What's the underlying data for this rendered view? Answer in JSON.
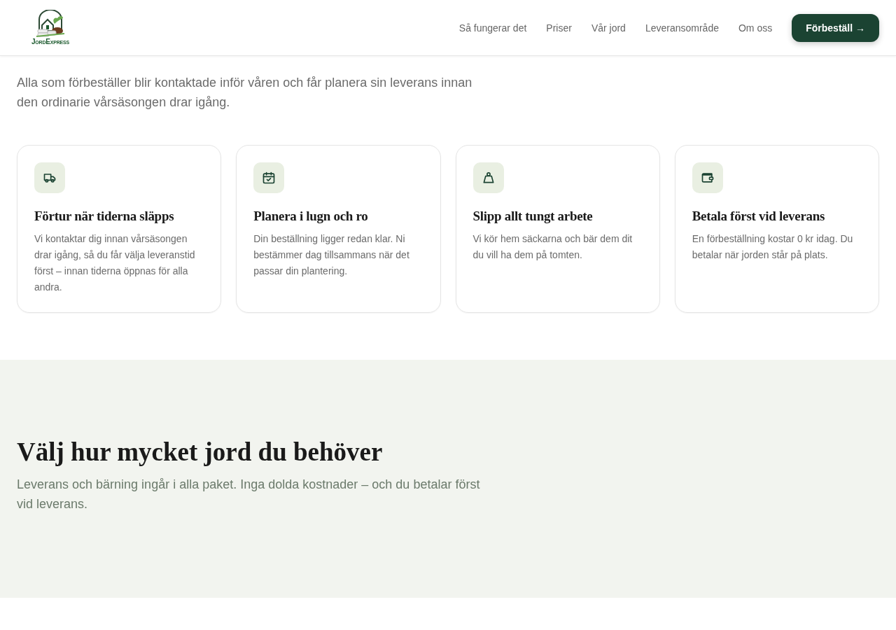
{
  "header": {
    "logo_text": "JordExpress",
    "nav": [
      {
        "label": "Så fungerar det"
      },
      {
        "label": "Priser"
      },
      {
        "label": "Vår jord"
      },
      {
        "label": "Leveransområde"
      },
      {
        "label": "Om oss"
      }
    ],
    "cta": "Förbeställ →"
  },
  "intro": {
    "text": "Alla som förbeställer blir kontaktade inför våren och får planera sin leverans innan den ordinarie vårsäsongen drar igång."
  },
  "cards": [
    {
      "kind": "truck",
      "title": "Förtur när tiderna släpps",
      "text": "Vi kontaktar dig innan vårsäsongen drar igång, så du får välja leveranstid först – innan tiderna öppnas för alla andra."
    },
    {
      "kind": "calendar",
      "title": "Planera i lugn och ro",
      "text": "Din beställning ligger redan klar. Ni bestämmer dag tillsammans när det passar din plantering."
    },
    {
      "kind": "weight",
      "title": "Slipp allt tungt arbete",
      "text": "Vi kör hem säckarna och bär dem dit du vill ha dem på tomten."
    },
    {
      "kind": "wallet",
      "title": "Betala först vid leverans",
      "text": "En förbeställning kostar 0 kr idag. Du betalar när jorden står på plats."
    }
  ],
  "pricing": {
    "heading": "Välj hur mycket jord du behöver",
    "text": "Leverans och bärning ingår i alla paket. Inga dolda kostnader – och du betalar först vid leverans."
  }
}
